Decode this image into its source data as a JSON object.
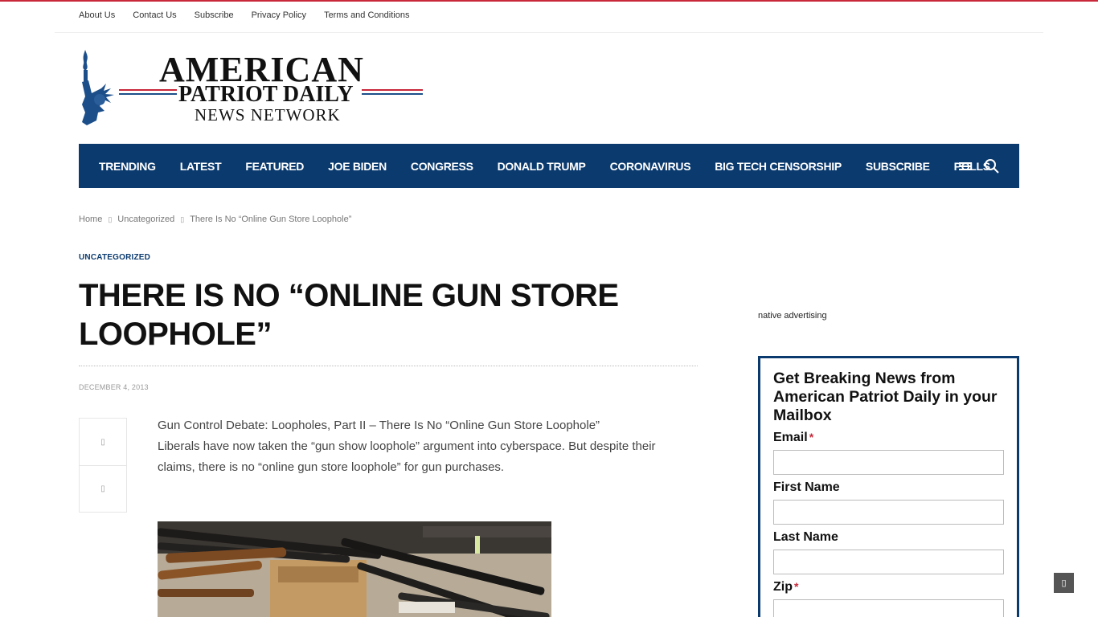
{
  "topbar": {
    "links": [
      "About Us",
      "Contact Us",
      "Subscribe",
      "Privacy Policy",
      "Terms and Conditions"
    ]
  },
  "logo": {
    "line1": "AMERICAN",
    "line2": "PATRIOT DAILY",
    "line3": "NEWS NETWORK"
  },
  "nav": {
    "items": [
      "TRENDING",
      "LATEST",
      "FEATURED",
      "JOE BIDEN",
      "CONGRESS",
      "DONALD TRUMP",
      "CORONAVIRUS",
      "BIG TECH CENSORSHIP",
      "SUBSCRIBE",
      "POLLS"
    ],
    "menu_icon": "hamburger-icon",
    "search_icon": "search-icon"
  },
  "breadcrumb": {
    "home": "Home",
    "category": "Uncategorized",
    "current": "There Is No “Online Gun Store Loophole”",
    "separator": "▯"
  },
  "article": {
    "category": "UNCATEGORIZED",
    "title": "THERE IS NO “ONLINE GUN STORE LOOPHOLE”",
    "date": "DECEMBER 4, 2013",
    "line1": "Gun Control Debate: Loopholes, Part II – There Is No “Online Gun Store Loophole”",
    "line2": "Liberals have now taken the “gun show loophole” argument into cyberspace. But despite their claims, there is no “online gun store loophole” for gun purchases.",
    "share_icon_1": "▯",
    "share_icon_2": "▯"
  },
  "sidebar": {
    "native_ad": "native advertising",
    "signup": {
      "heading": "Get Breaking News from American Patriot Daily in your Mailbox",
      "email_label": "Email",
      "first_name_label": "First Name",
      "last_name_label": "Last Name",
      "zip_label": "Zip",
      "required_mark": "*"
    }
  },
  "scroll_top_icon": "▯",
  "colors": {
    "nav_bg": "#0b3a6e",
    "accent_red": "#c8283a",
    "category_blue": "#0b3a6e"
  }
}
